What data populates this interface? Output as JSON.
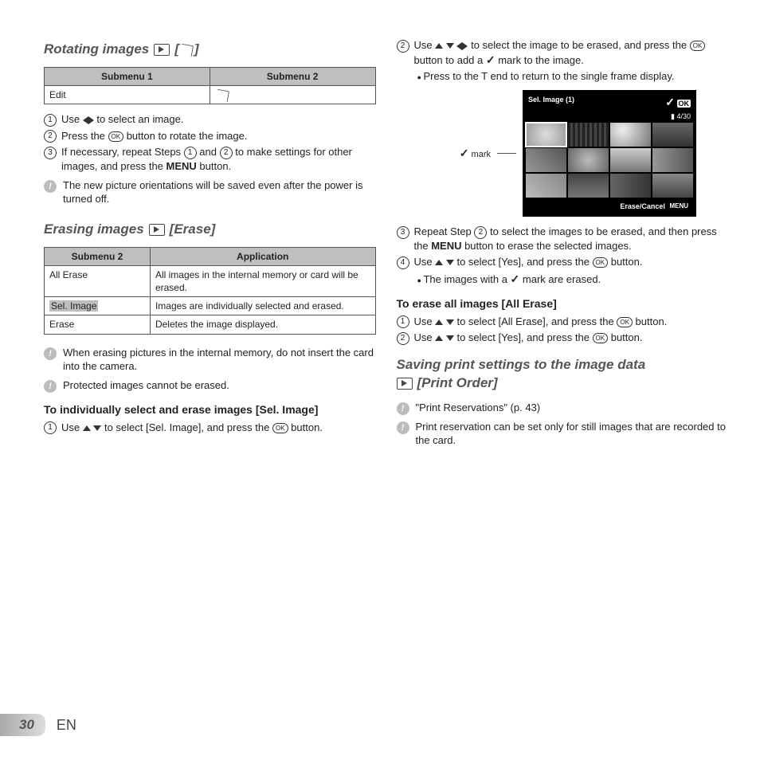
{
  "left": {
    "rotating": {
      "title_pre": "Rotating images",
      "title_brackets": "[",
      "title_post": "]",
      "table_h1": "Submenu 1",
      "table_h2": "Submenu 2",
      "row1_c1": "Edit",
      "step1_a": "Use ",
      "step1_b": " to select an image.",
      "step2_a": "Press the ",
      "step2_b": " button to rotate the image.",
      "step3_a": "If necessary, repeat Steps ",
      "step3_b": " and ",
      "step3_c": " to make settings for other images, and press the ",
      "step3_d": "MENU",
      "step3_e": " button.",
      "note1": "The new picture orientations will be saved even after the power is turned off."
    },
    "erasing": {
      "title_pre": "Erasing images",
      "title_brackets": "[Erase]",
      "th1": "Submenu 2",
      "th2": "Application",
      "r1c1": "All Erase",
      "r1c2": "All images in the internal memory or card will be erased.",
      "r2c1": "Sel. Image",
      "r2c2": "Images are individually selected and erased.",
      "r3c1": "Erase",
      "r3c2": "Deletes the image displayed.",
      "note1": "When erasing pictures in the internal memory, do not insert the card into the camera.",
      "note2": "Protected images cannot be erased.",
      "sub_head": "To individually select and erase images [Sel. Image]",
      "sel_step1_a": "Use ",
      "sel_step1_b": " to select [Sel. Image], and press the ",
      "sel_step1_c": " button."
    }
  },
  "right": {
    "step2_a": "Use ",
    "step2_b": " to select the image to be erased, and press the ",
    "step2_c": " button to add a ",
    "step2_d": " mark to the image.",
    "bullet1": "Press to the T end to return to the single frame display.",
    "cam": {
      "mark_label": "mark",
      "title": "Sel. Image (1)",
      "ok": "OK",
      "count": "4/30",
      "bottom": "Erase/Cancel",
      "menu": "MENU"
    },
    "step3_a": "Repeat Step ",
    "step3_b": " to select the images to be erased, and then press the ",
    "step3_c": "MENU",
    "step3_d": " button to erase the selected images.",
    "step4_a": "Use ",
    "step4_b": " to select [Yes], and press the ",
    "step4_c": " button.",
    "bullet2_a": "The images with a ",
    "bullet2_b": " mark are erased.",
    "allerase_head": "To erase all images [All Erase]",
    "ae_step1_a": "Use ",
    "ae_step1_b": " to select [All Erase], and press the ",
    "ae_step1_c": " button.",
    "ae_step2_a": "Use ",
    "ae_step2_b": " to select [Yes], and press the ",
    "ae_step2_c": " button.",
    "print": {
      "title_pre": "Saving print settings to the image data",
      "title_post": "[Print Order]",
      "note1": "\"Print Reservations\" (p. 43)",
      "note2": "Print reservation can be set only for still images that are recorded to the card."
    }
  },
  "footer": {
    "page": "30",
    "lang": "EN"
  }
}
